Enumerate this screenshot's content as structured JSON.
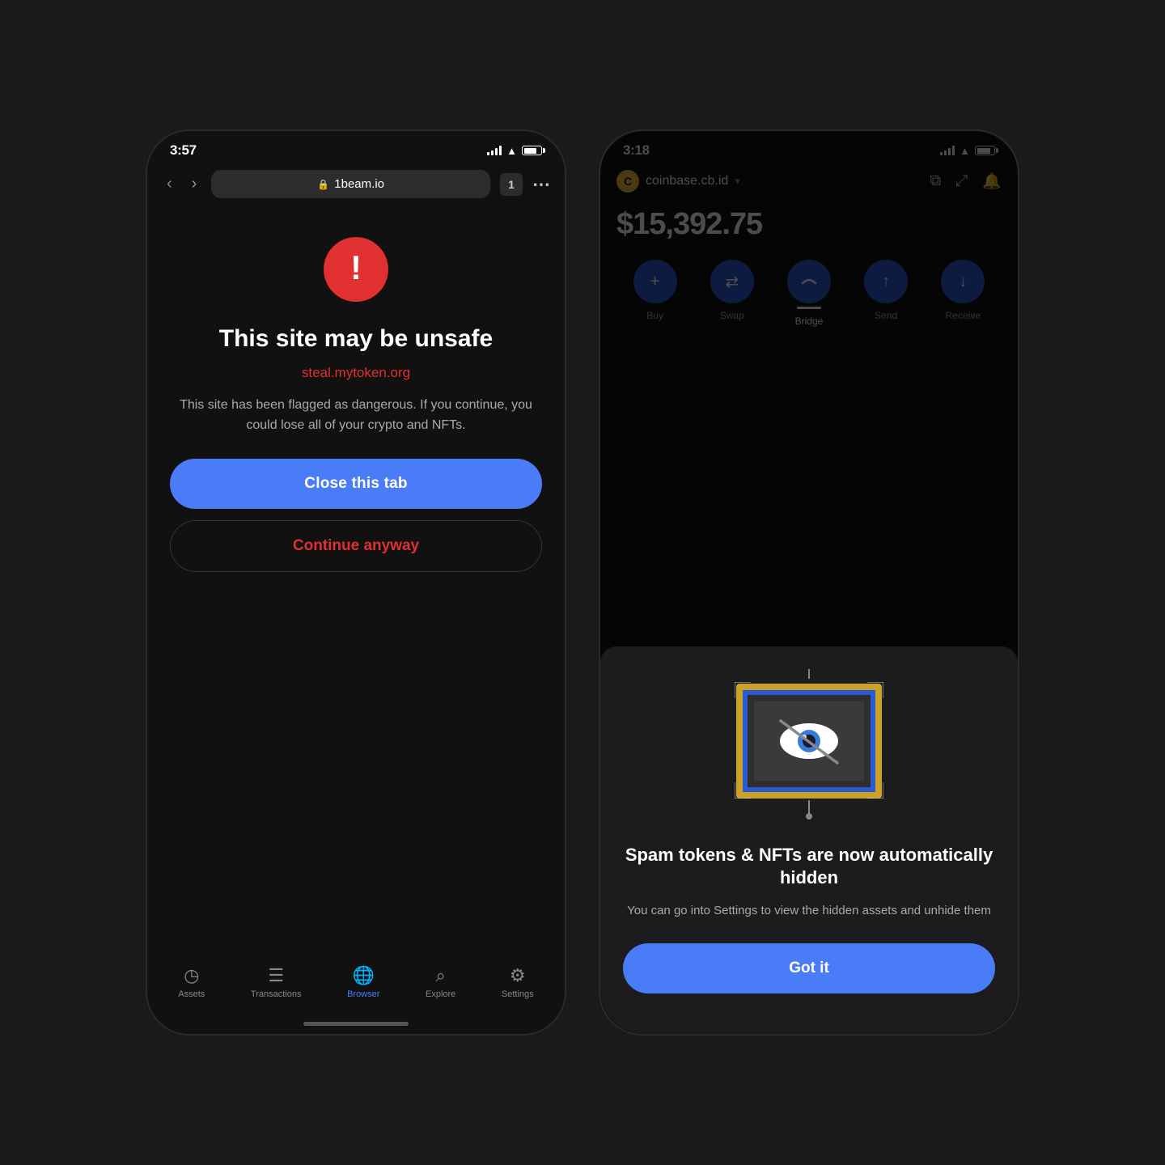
{
  "phone1": {
    "status_time": "3:57",
    "url": "1beam.io",
    "tab_count": "1",
    "warning_title": "This site may be  unsafe",
    "warning_url": "steal.mytoken.org",
    "warning_desc": "This site has been flagged as dangerous. If you continue, you could lose all of your crypto and NFTs.",
    "close_tab_label": "Close this tab",
    "continue_label": "Continue anyway",
    "nav_items": [
      {
        "label": "Assets",
        "icon": "🕐",
        "active": false
      },
      {
        "label": "Transactions",
        "icon": "☰",
        "active": false
      },
      {
        "label": "Browser",
        "icon": "🌐",
        "active": true
      },
      {
        "label": "Explore",
        "icon": "🔍",
        "active": false
      },
      {
        "label": "Settings",
        "icon": "⚙",
        "active": false
      }
    ]
  },
  "phone2": {
    "status_time": "3:18",
    "domain": "coinbase.cb.id",
    "balance": "$15,392.75",
    "actions": [
      {
        "label": "Buy",
        "icon": "+",
        "active": false
      },
      {
        "label": "Swap",
        "icon": "⇄",
        "active": false
      },
      {
        "label": "Bridge",
        "icon": "⌒",
        "active": true
      },
      {
        "label": "Send",
        "icon": "↑",
        "active": false
      },
      {
        "label": "Receive",
        "icon": "↓",
        "active": false
      }
    ],
    "modal_title": "Spam tokens & NFTs are now automatically hidden",
    "modal_desc": "You can go into Settings to view the hidden assets and unhide them",
    "got_it_label": "Got it"
  }
}
